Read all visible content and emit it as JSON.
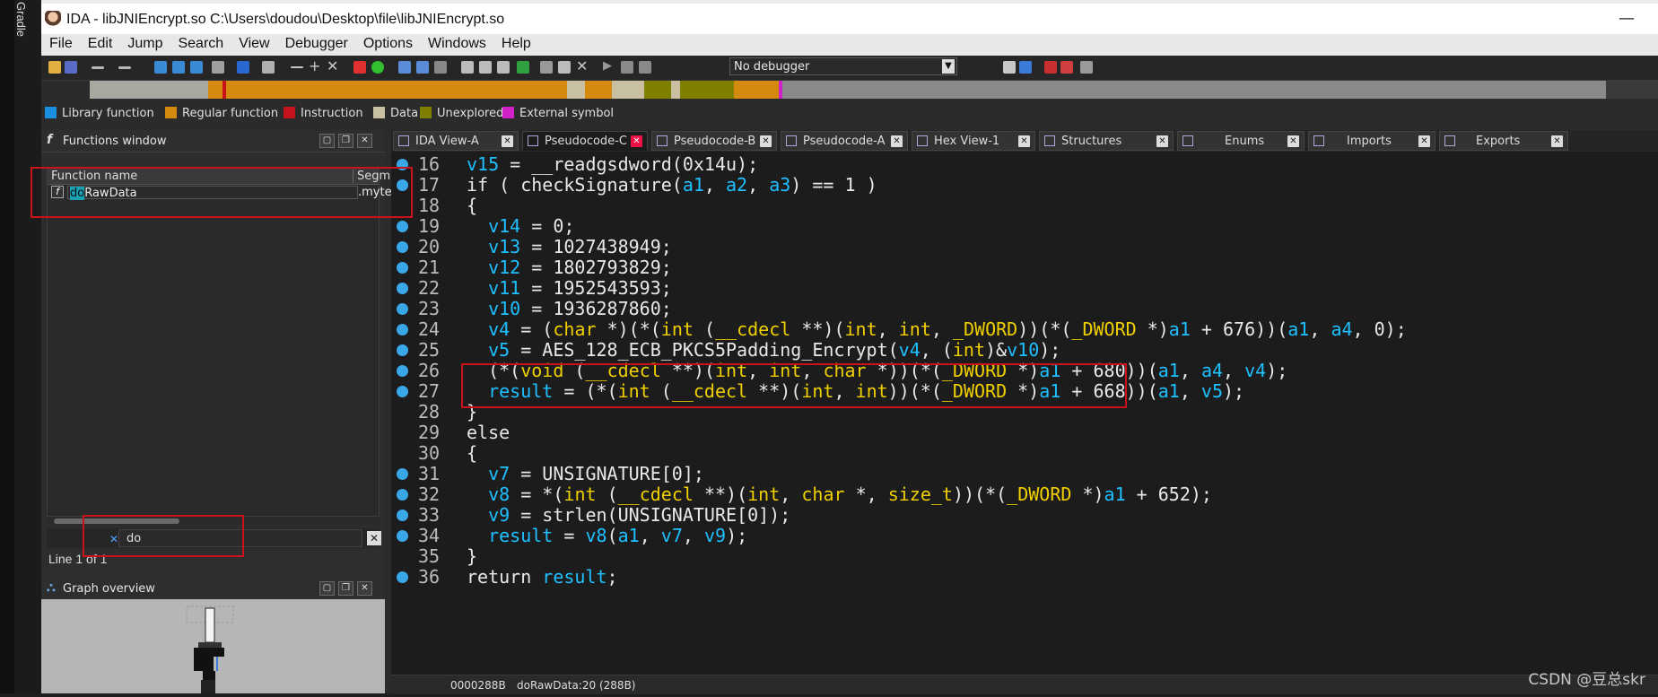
{
  "left_strip": {
    "label": "Gradle"
  },
  "window": {
    "title": "IDA - libJNIEncrypt.so C:\\Users\\doudou\\Desktop\\file\\libJNIEncrypt.so",
    "minimize": "—"
  },
  "menu": [
    "File",
    "Edit",
    "Jump",
    "Search",
    "View",
    "Debugger",
    "Options",
    "Windows",
    "Help"
  ],
  "toolbar": {
    "debugger": "No debugger"
  },
  "legend": [
    {
      "label": "Library function",
      "color": "#1a8fe0"
    },
    {
      "label": "Regular function",
      "color": "#d48a0c"
    },
    {
      "label": "Instruction",
      "color": "#c8121c"
    },
    {
      "label": "Data",
      "color": "#c8c0a0"
    },
    {
      "label": "Unexplored",
      "color": "#808000"
    },
    {
      "label": "External symbol",
      "color": "#d020c8"
    }
  ],
  "functions": {
    "title": "Functions window",
    "col_name": "Function name",
    "col_segment": "Segm",
    "rows": [
      {
        "name_highlight": "do",
        "name_rest": "RawData",
        "segment": ".myte"
      }
    ],
    "search": "do",
    "status": "Line 1 of 1"
  },
  "graph": {
    "title": "Graph overview"
  },
  "tabs": [
    {
      "label": "IDA View-A",
      "active": false
    },
    {
      "label": "Pseudocode-C",
      "active": true
    },
    {
      "label": "Pseudocode-B",
      "active": false
    },
    {
      "label": "Pseudocode-A",
      "active": false
    },
    {
      "label": "Hex View-1",
      "active": false
    },
    {
      "label": "Structures",
      "active": false
    },
    {
      "label": "Enums",
      "active": false
    },
    {
      "label": "Imports",
      "active": false
    },
    {
      "label": "Exports",
      "active": false
    }
  ],
  "code": [
    {
      "ln": "16",
      "bp": true,
      "text": "v15 = __readgsdword(0x14u);"
    },
    {
      "ln": "17",
      "bp": true,
      "text": "if ( checkSignature(a1, a2, a3) == 1 )"
    },
    {
      "ln": "18",
      "bp": false,
      "text": "{"
    },
    {
      "ln": "19",
      "bp": true,
      "text": "  v14 = 0;"
    },
    {
      "ln": "20",
      "bp": true,
      "text": "  v13 = 1027438949;"
    },
    {
      "ln": "21",
      "bp": true,
      "text": "  v12 = 1802793829;"
    },
    {
      "ln": "22",
      "bp": true,
      "text": "  v11 = 1952543593;"
    },
    {
      "ln": "23",
      "bp": true,
      "text": "  v10 = 1936287860;"
    },
    {
      "ln": "24",
      "bp": true,
      "text": "  v4 = (char *)(*(int (__cdecl **)(int, int, _DWORD))(*(_DWORD *)a1 + 676))(a1, a4, 0);"
    },
    {
      "ln": "25",
      "bp": true,
      "text": "  v5 = AES_128_ECB_PKCS5Padding_Encrypt(v4, (int)&v10);"
    },
    {
      "ln": "26",
      "bp": true,
      "text": "  (*(void (__cdecl **)(int, int, char *))(*(_DWORD *)a1 + 680))(a1, a4, v4);"
    },
    {
      "ln": "27",
      "bp": true,
      "text": "  result = (*(int (__cdecl **)(int, int))(*(_DWORD *)a1 + 668))(a1, v5);"
    },
    {
      "ln": "28",
      "bp": false,
      "text": "}"
    },
    {
      "ln": "29",
      "bp": false,
      "text": "else"
    },
    {
      "ln": "30",
      "bp": false,
      "text": "{"
    },
    {
      "ln": "31",
      "bp": true,
      "text": "  v7 = UNSIGNATURE[0];"
    },
    {
      "ln": "32",
      "bp": true,
      "text": "  v8 = *(int (__cdecl **)(int, char *, size_t))(*(_DWORD *)a1 + 652);"
    },
    {
      "ln": "33",
      "bp": true,
      "text": "  v9 = strlen(UNSIGNATURE[0]);"
    },
    {
      "ln": "34",
      "bp": true,
      "text": "  result = v8(a1, v7, v9);"
    },
    {
      "ln": "35",
      "bp": false,
      "text": "}"
    },
    {
      "ln": "36",
      "bp": true,
      "text": "return result;"
    }
  ],
  "status": {
    "address": "0000288B",
    "location": "doRawData:20 (288B)"
  },
  "watermark": "CSDN @豆总skr"
}
